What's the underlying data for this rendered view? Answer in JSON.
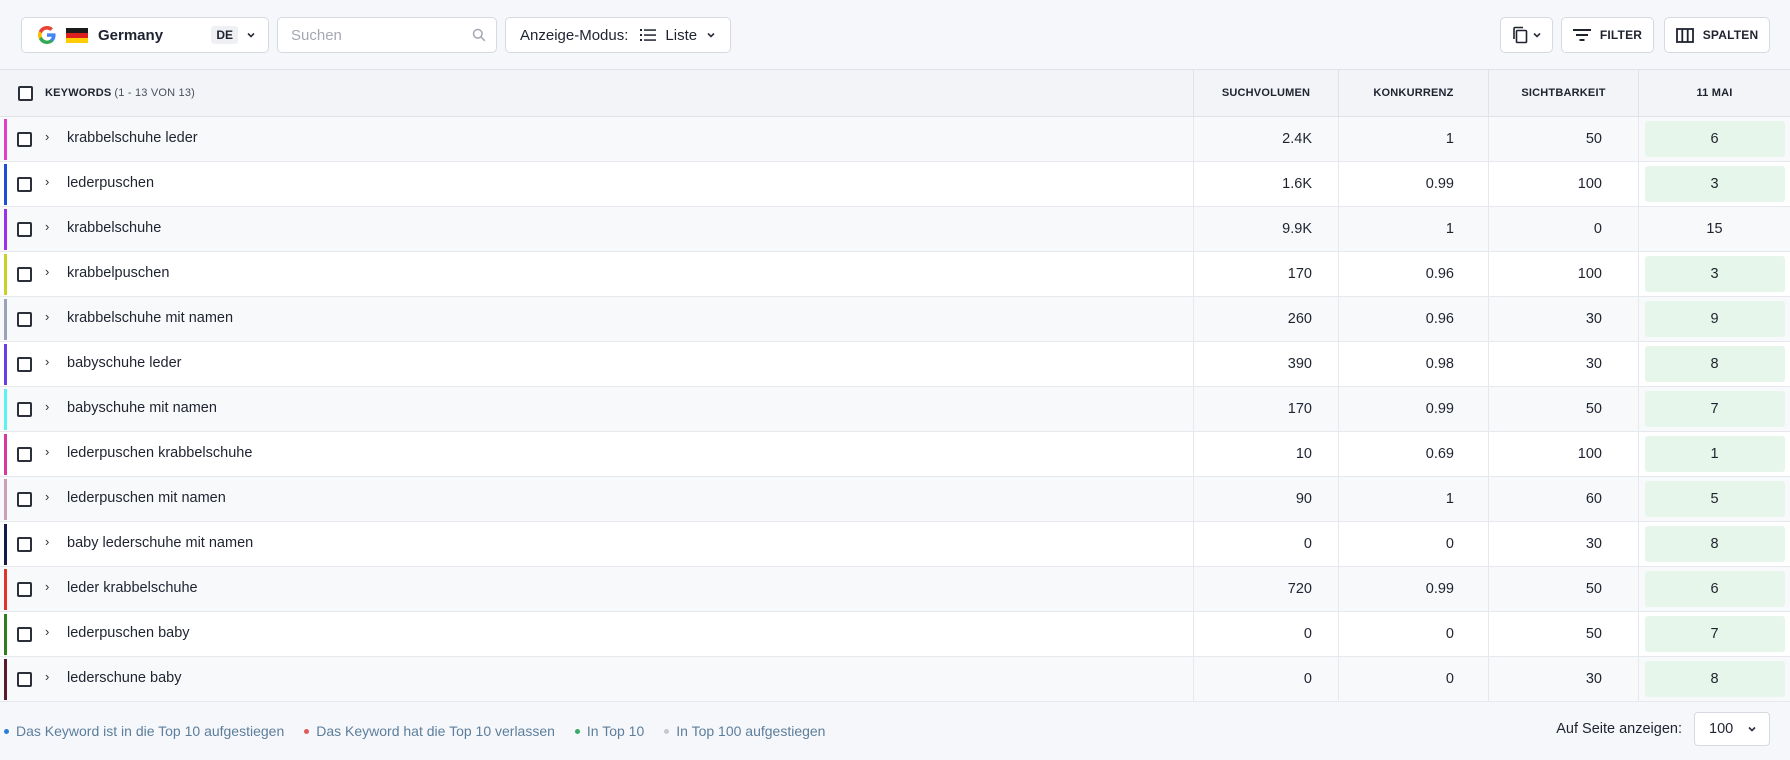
{
  "toolbar": {
    "country": {
      "name": "Germany",
      "lang": "DE",
      "icon": "google-g-icon"
    },
    "search": {
      "placeholder": "Suchen",
      "value": "",
      "icon": "search-icon"
    },
    "display_mode": {
      "label": "Anzeige-Modus:",
      "value": "Liste",
      "icon": "list-icon"
    },
    "copy_icon": "copy-icon",
    "filter_label": "FILTER",
    "columns_label": "SPALTEN"
  },
  "table": {
    "headers": {
      "keywords": "KEYWORDS",
      "keywords_count": "(1 - 13 VON 13)",
      "search_volume": "SUCHVOLUMEN",
      "competition": "KONKURRENZ",
      "visibility": "SICHTBARKEIT",
      "date": "11 MAI"
    },
    "rows": [
      {
        "keyword": "krabbelschuhe leder",
        "search_volume": "2.4K",
        "competition": "1",
        "visibility": "50",
        "rank": "6",
        "color": "#e040c8",
        "highlight": true
      },
      {
        "keyword": "lederpuschen",
        "search_volume": "1.6K",
        "competition": "0.99",
        "visibility": "100",
        "rank": "3",
        "color": "#1a4fd6",
        "highlight": true
      },
      {
        "keyword": "krabbelschuhe",
        "search_volume": "9.9K",
        "competition": "1",
        "visibility": "0",
        "rank": "15",
        "color": "#9b30e8",
        "highlight": false
      },
      {
        "keyword": "krabbelpuschen",
        "search_volume": "170",
        "competition": "0.96",
        "visibility": "100",
        "rank": "3",
        "color": "#c8d12a",
        "highlight": true
      },
      {
        "keyword": "krabbelschuhe mit namen",
        "search_volume": "260",
        "competition": "0.96",
        "visibility": "30",
        "rank": "9",
        "color": "#9aa3b8",
        "highlight": true
      },
      {
        "keyword": "babyschuhe leder",
        "search_volume": "390",
        "competition": "0.98",
        "visibility": "30",
        "rank": "8",
        "color": "#6a3fe0",
        "highlight": true
      },
      {
        "keyword": "babyschuhe mit namen",
        "search_volume": "170",
        "competition": "0.99",
        "visibility": "50",
        "rank": "7",
        "color": "#5ff0f0",
        "highlight": true
      },
      {
        "keyword": "lederpuschen krabbelschuhe",
        "search_volume": "10",
        "competition": "0.69",
        "visibility": "100",
        "rank": "1",
        "color": "#d63a9a",
        "highlight": true
      },
      {
        "keyword": "lederpuschen mit namen",
        "search_volume": "90",
        "competition": "1",
        "visibility": "60",
        "rank": "5",
        "color": "#c9a0b8",
        "highlight": true
      },
      {
        "keyword": "baby lederschuhe mit namen",
        "search_volume": "0",
        "competition": "0",
        "visibility": "30",
        "rank": "8",
        "color": "#141a4a",
        "highlight": true
      },
      {
        "keyword": "leder krabbelschuhe",
        "search_volume": "720",
        "competition": "0.99",
        "visibility": "50",
        "rank": "6",
        "color": "#e0342a",
        "highlight": true
      },
      {
        "keyword": "lederpuschen baby",
        "search_volume": "0",
        "competition": "0",
        "visibility": "50",
        "rank": "7",
        "color": "#2e7d1e",
        "highlight": true
      },
      {
        "keyword": "lederschune baby",
        "search_volume": "0",
        "competition": "0",
        "visibility": "30",
        "rank": "8",
        "color": "#5a1a2a",
        "highlight": true
      }
    ]
  },
  "footer": {
    "legend": [
      {
        "label": "Das Keyword ist in die Top 10 aufgestiegen",
        "color": "#2a7fd6"
      },
      {
        "label": "Das Keyword hat die Top 10 verlassen",
        "color": "#e05a5a"
      },
      {
        "label": "In Top 10",
        "color": "#3aa868"
      },
      {
        "label": "In Top 100 aufgestiegen",
        "color": "#c4c8d0"
      }
    ],
    "per_page_label": "Auf Seite anzeigen:",
    "per_page_value": "100"
  },
  "colors": {
    "rank_green_bg": "#e6f6ea",
    "header_bg": "#f2f4f8"
  }
}
